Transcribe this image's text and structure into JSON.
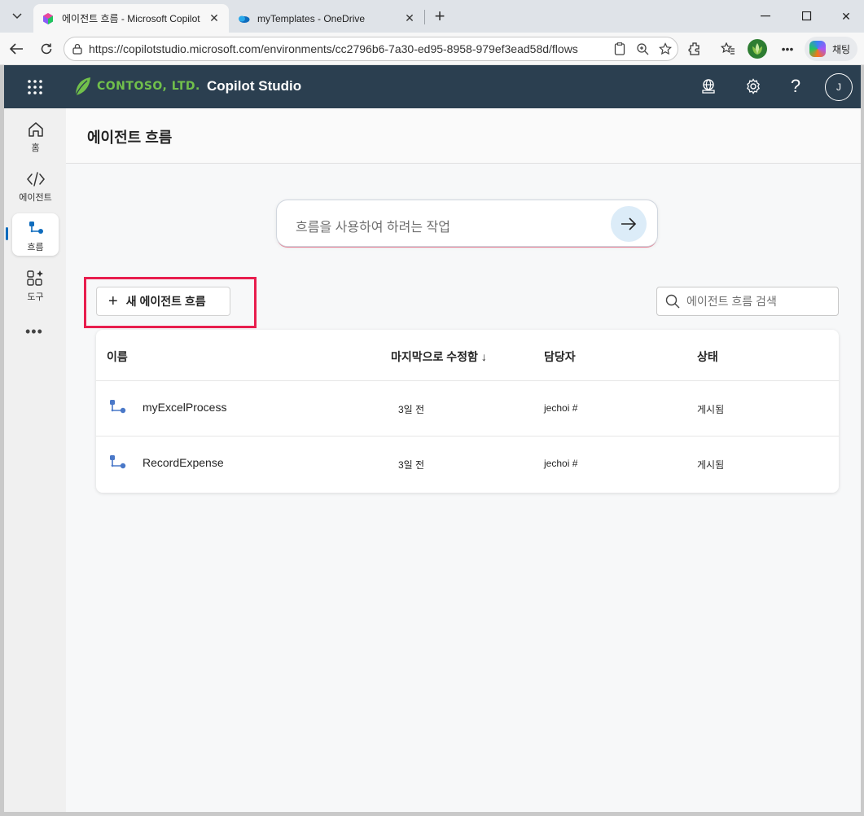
{
  "browser": {
    "tabs": [
      {
        "title": "에이전트 흐름 - Microsoft Copilot",
        "active": true
      },
      {
        "title": "myTemplates - OneDrive",
        "active": false
      }
    ],
    "url": "https://copilotstudio.microsoft.com/environments/cc2796b6-7a30-ed95-8958-979ef3ead58d/flows",
    "chat_label": "채팅"
  },
  "header": {
    "org_name": "CONTOSO, LTD.",
    "app_title": "Copilot Studio",
    "avatar_initial": "J"
  },
  "rail": {
    "items": [
      {
        "label": "홈",
        "icon": "home-icon"
      },
      {
        "label": "에이전트",
        "icon": "code-icon"
      },
      {
        "label": "흐름",
        "icon": "flow-icon",
        "active": true
      },
      {
        "label": "도구",
        "icon": "tools-icon"
      }
    ],
    "more": "•••"
  },
  "page": {
    "title": "에이전트 흐름",
    "prompt_placeholder": "흐름을 사용하여 하려는 작업",
    "new_flow_label": "새 에이전트 흐름",
    "search_placeholder": "에이전트 흐름 검색"
  },
  "table": {
    "columns": [
      "이름",
      "마지막으로 수정함 ↓",
      "담당자",
      "상태"
    ],
    "rows": [
      {
        "name": "myExcelProcess",
        "modified": "3일 전",
        "owner": "jechoi #",
        "status": "게시됨"
      },
      {
        "name": "RecordExpense",
        "modified": "3일 전",
        "owner": "jechoi #",
        "status": "게시됨"
      }
    ]
  },
  "colors": {
    "header_bg": "#2b3f50",
    "accent": "#0f6cbd",
    "highlight_box": "#e81e4e",
    "brand_green": "#71c04b"
  }
}
